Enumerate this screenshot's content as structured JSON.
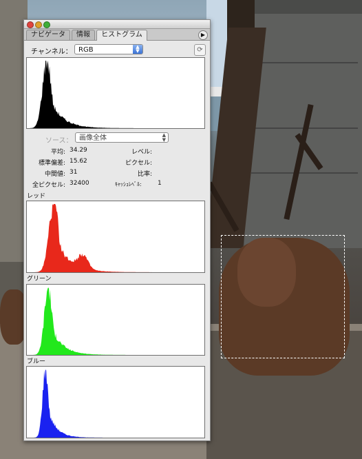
{
  "tabs": [
    {
      "label": "ナビゲータ",
      "active": false
    },
    {
      "label": "情報",
      "active": false
    },
    {
      "label": "ヒストグラム",
      "active": true
    }
  ],
  "channel": {
    "label": "チャンネル：",
    "value": "RGB"
  },
  "source": {
    "label": "ソース：",
    "value": "画像全体"
  },
  "stats": {
    "mean_label": "平均:",
    "mean": "34.29",
    "stddev_label": "標準偏差:",
    "stddev": "15.62",
    "median_label": "中間値:",
    "median": "31",
    "pixels_label": "全ピクセル:",
    "pixels": "32400",
    "level_label": "レベル:",
    "count_label": "ピクセル:",
    "percentile_label": "比率:",
    "cache_label": "ｷｬｯｼｭﾚﾍﾞﾙ:",
    "cache": "1"
  },
  "sections": {
    "red": "レッド",
    "green": "グリーン",
    "blue": "ブルー"
  },
  "colors": {
    "composite": "#000000",
    "red": "#e8281b",
    "green": "#22e81c",
    "blue": "#1a22f0",
    "accent": "#3a73d6"
  },
  "icons": {
    "menu": "triangle-right-icon",
    "refresh": "refresh-icon",
    "dropdown": "up-down-arrows-icon"
  }
}
